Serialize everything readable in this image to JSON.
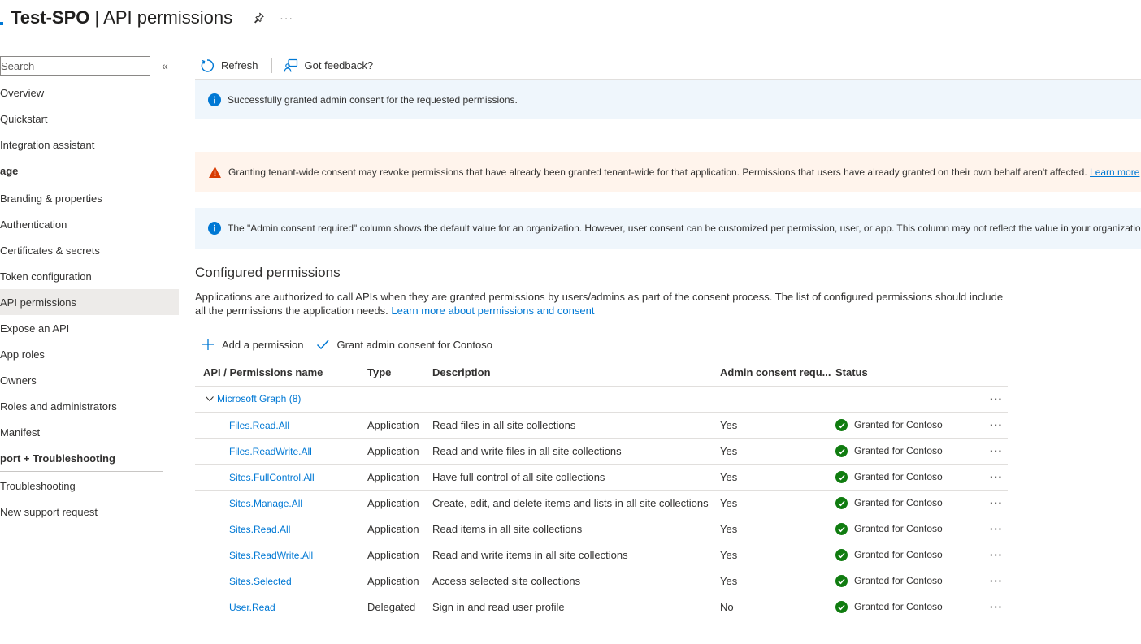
{
  "header": {
    "app_name": "Test-SPO",
    "separator": "|",
    "page_name": "API permissions",
    "more": "···"
  },
  "sidebar": {
    "search_placeholder": "Search",
    "collapse": "«",
    "items_top": [
      {
        "label": "Overview"
      },
      {
        "label": "Quickstart"
      },
      {
        "label": "Integration assistant"
      }
    ],
    "manage_heading": "age",
    "items_manage": [
      {
        "label": "Branding & properties"
      },
      {
        "label": "Authentication"
      },
      {
        "label": "Certificates & secrets"
      },
      {
        "label": "Token configuration"
      },
      {
        "label": "API permissions",
        "active": true
      },
      {
        "label": "Expose an API"
      },
      {
        "label": "App roles"
      },
      {
        "label": "Owners"
      },
      {
        "label": "Roles and administrators"
      },
      {
        "label": "Manifest"
      }
    ],
    "support_heading": "port + Troubleshooting",
    "items_support": [
      {
        "label": "Troubleshooting"
      },
      {
        "label": "New support request"
      }
    ]
  },
  "toolbar": {
    "refresh_label": "Refresh",
    "feedback_label": "Got feedback?"
  },
  "banners": {
    "success_text": "Successfully granted admin consent for the requested permissions.",
    "warning_text": "Granting tenant-wide consent may revoke permissions that have already been granted tenant-wide for that application. Permissions that users have already granted on their own behalf aren't affected.",
    "warning_link": "Learn more",
    "info_text": "The \"Admin consent required\" column shows the default value for an organization. However, user consent can be customized per permission, user, or app. This column may not reflect the value in your organization"
  },
  "configured": {
    "title": "Configured permissions",
    "desc": "Applications are authorized to call APIs when they are granted permissions by users/admins as part of the consent process. The list of configured permissions should include all the permissions the application needs.",
    "desc_link": "Learn more about permissions and consent",
    "add_label": "Add a permission",
    "grant_label": "Grant admin consent for Contoso"
  },
  "table": {
    "headers": {
      "name": "API / Permissions name",
      "type": "Type",
      "description": "Description",
      "admin": "Admin consent requ...",
      "status": "Status"
    },
    "group": "Microsoft Graph (8)",
    "more": "···",
    "rows": [
      {
        "name": "Files.Read.All",
        "type": "Application",
        "description": "Read files in all site collections",
        "admin": "Yes",
        "status": "Granted for Contoso"
      },
      {
        "name": "Files.ReadWrite.All",
        "type": "Application",
        "description": "Read and write files in all site collections",
        "admin": "Yes",
        "status": "Granted for Contoso"
      },
      {
        "name": "Sites.FullControl.All",
        "type": "Application",
        "description": "Have full control of all site collections",
        "admin": "Yes",
        "status": "Granted for Contoso"
      },
      {
        "name": "Sites.Manage.All",
        "type": "Application",
        "description": "Create, edit, and delete items and lists in all site collections",
        "admin": "Yes",
        "status": "Granted for Contoso"
      },
      {
        "name": "Sites.Read.All",
        "type": "Application",
        "description": "Read items in all site collections",
        "admin": "Yes",
        "status": "Granted for Contoso"
      },
      {
        "name": "Sites.ReadWrite.All",
        "type": "Application",
        "description": "Read and write items in all site collections",
        "admin": "Yes",
        "status": "Granted for Contoso"
      },
      {
        "name": "Sites.Selected",
        "type": "Application",
        "description": "Access selected site collections",
        "admin": "Yes",
        "status": "Granted for Contoso"
      },
      {
        "name": "User.Read",
        "type": "Delegated",
        "description": "Sign in and read user profile",
        "admin": "No",
        "status": "Granted for Contoso"
      }
    ]
  },
  "colors": {
    "accent": "#0078d4",
    "success": "#107c10",
    "warning": "#d83b01",
    "info_bg": "#eff6fc",
    "warn_bg": "#fff4ec"
  }
}
